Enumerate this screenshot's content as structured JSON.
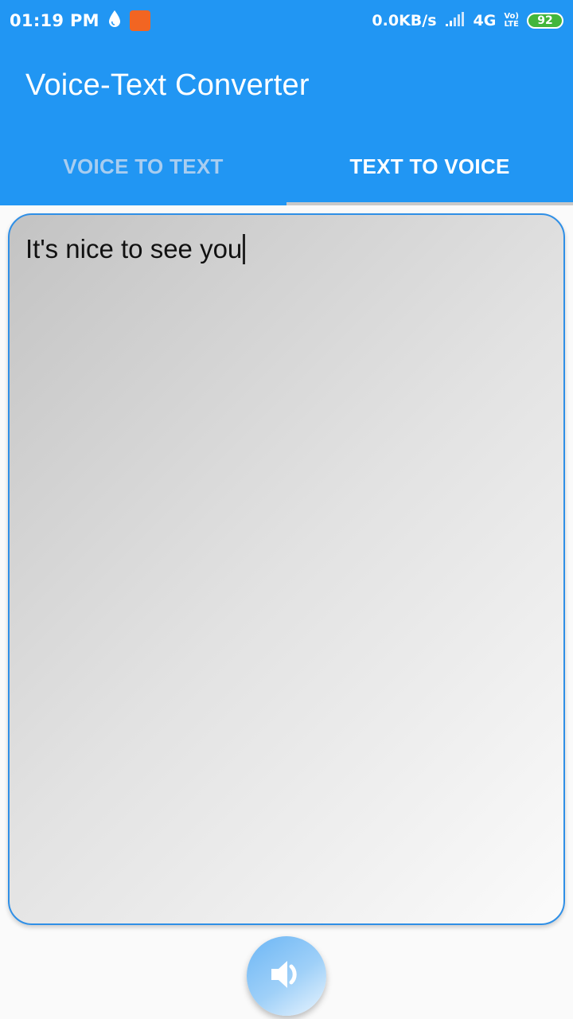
{
  "status_bar": {
    "time": "01:19 PM",
    "speed": "0.0KB/s",
    "network": "4G",
    "volte_top": "Vo)",
    "volte_bottom": "LTE",
    "battery": "92"
  },
  "app_bar": {
    "title": "Voice-Text Converter"
  },
  "tabs": [
    {
      "label": "VOICE TO TEXT",
      "active": false
    },
    {
      "label": "TEXT TO VOICE",
      "active": true
    }
  ],
  "editor": {
    "value": "It's nice to see you"
  },
  "icons": {
    "drop": "water-drop-icon",
    "signal": "signal-icon",
    "speak": "speaker-icon"
  },
  "colors": {
    "primary": "#2196f3",
    "card_border": "#2f8fe6",
    "battery": "#43b63b",
    "orange_app": "#f26522"
  }
}
